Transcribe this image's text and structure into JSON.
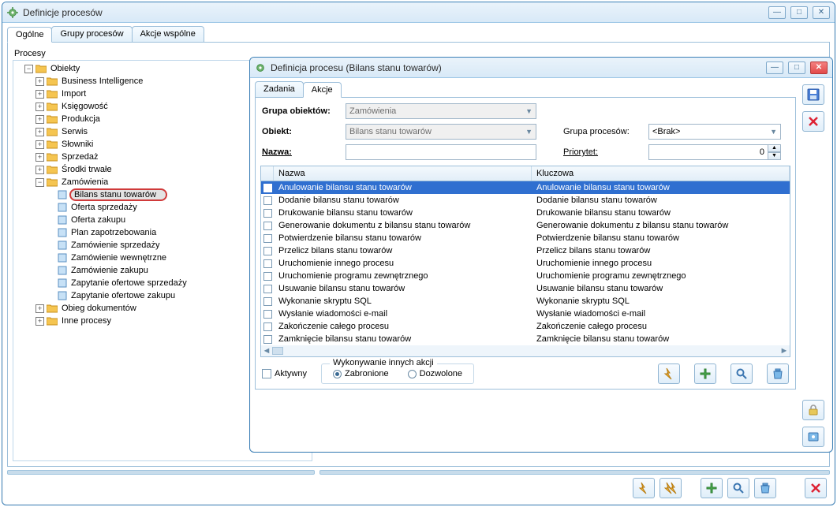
{
  "outer": {
    "title": "Definicje procesów",
    "tabs": [
      "Ogólne",
      "Grupy procesów",
      "Akcje wspólne"
    ],
    "active_tab": 0,
    "panel_label": "Procesy",
    "tree": {
      "root": "Obiekty",
      "children": [
        {
          "label": "Business Intelligence"
        },
        {
          "label": "Import"
        },
        {
          "label": "Księgowość"
        },
        {
          "label": "Produkcja"
        },
        {
          "label": "Serwis"
        },
        {
          "label": "Słowniki"
        },
        {
          "label": "Sprzedaż"
        },
        {
          "label": "Środki trwałe"
        },
        {
          "label": "Zamówienia",
          "expanded": true,
          "children": [
            {
              "label": "Bilans stanu towarów",
              "selected": true
            },
            {
              "label": "Oferta sprzedaży"
            },
            {
              "label": "Oferta zakupu"
            },
            {
              "label": "Plan zapotrzebowania"
            },
            {
              "label": "Zamówienie sprzedaży"
            },
            {
              "label": "Zamówienie wewnętrzne"
            },
            {
              "label": "Zamówienie zakupu"
            },
            {
              "label": "Zapytanie ofertowe sprzedaży"
            },
            {
              "label": "Zapytanie ofertowe zakupu"
            }
          ]
        },
        {
          "label": "Obieg dokumentów"
        },
        {
          "label": "Inne procesy"
        }
      ]
    }
  },
  "inner": {
    "title": "Definicja procesu (Bilans stanu towarów)",
    "tabs": [
      "Zadania",
      "Akcje"
    ],
    "active_tab": 1,
    "form": {
      "grupa_obiektow_label": "Grupa obiektów:",
      "grupa_obiektow_value": "Zamówienia",
      "obiekt_label": "Obiekt:",
      "obiekt_value": "Bilans stanu towarów",
      "nazwa_label": "Nazwa:",
      "nazwa_value": "",
      "grupa_procesow_label": "Grupa procesów:",
      "grupa_procesow_value": "<Brak>",
      "priorytet_label": "Priorytet:",
      "priorytet_value": "0"
    },
    "grid": {
      "columns": [
        "Nazwa",
        "Kluczowa"
      ],
      "rows": [
        {
          "nazwa": "Anulowanie bilansu stanu towarów",
          "kluczowa": "Anulowanie bilansu stanu towarów",
          "selected": true
        },
        {
          "nazwa": "Dodanie bilansu stanu towarów",
          "kluczowa": "Dodanie bilansu stanu towarów"
        },
        {
          "nazwa": "Drukowanie bilansu stanu towarów",
          "kluczowa": "Drukowanie bilansu stanu towarów"
        },
        {
          "nazwa": "Generowanie dokumentu z bilansu stanu towarów",
          "kluczowa": "Generowanie dokumentu z bilansu stanu towarów"
        },
        {
          "nazwa": "Potwierdzenie bilansu stanu towarów",
          "kluczowa": "Potwierdzenie bilansu stanu towarów"
        },
        {
          "nazwa": "Przelicz bilans stanu towarów",
          "kluczowa": "Przelicz bilans stanu towarów"
        },
        {
          "nazwa": "Uruchomienie innego procesu",
          "kluczowa": "Uruchomienie innego procesu"
        },
        {
          "nazwa": "Uruchomienie programu zewnętrznego",
          "kluczowa": "Uruchomienie programu zewnętrznego"
        },
        {
          "nazwa": "Usuwanie bilansu stanu towarów",
          "kluczowa": "Usuwanie bilansu stanu towarów"
        },
        {
          "nazwa": "Wykonanie skryptu SQL",
          "kluczowa": "Wykonanie skryptu SQL"
        },
        {
          "nazwa": "Wysłanie wiadomości e-mail",
          "kluczowa": "Wysłanie wiadomości e-mail"
        },
        {
          "nazwa": "Zakończenie całego procesu",
          "kluczowa": "Zakończenie całego procesu"
        },
        {
          "nazwa": "Zamknięcie bilansu stanu towarów",
          "kluczowa": "Zamknięcie bilansu stanu towarów"
        }
      ]
    },
    "bottom": {
      "aktywny_label": "Aktywny",
      "group_label": "Wykonywanie innych akcji",
      "radio_zabronione": "Zabronione",
      "radio_dozwolone": "Dozwolone"
    }
  },
  "icons": {
    "minimize": "—",
    "maximize": "□",
    "close": "✕"
  }
}
